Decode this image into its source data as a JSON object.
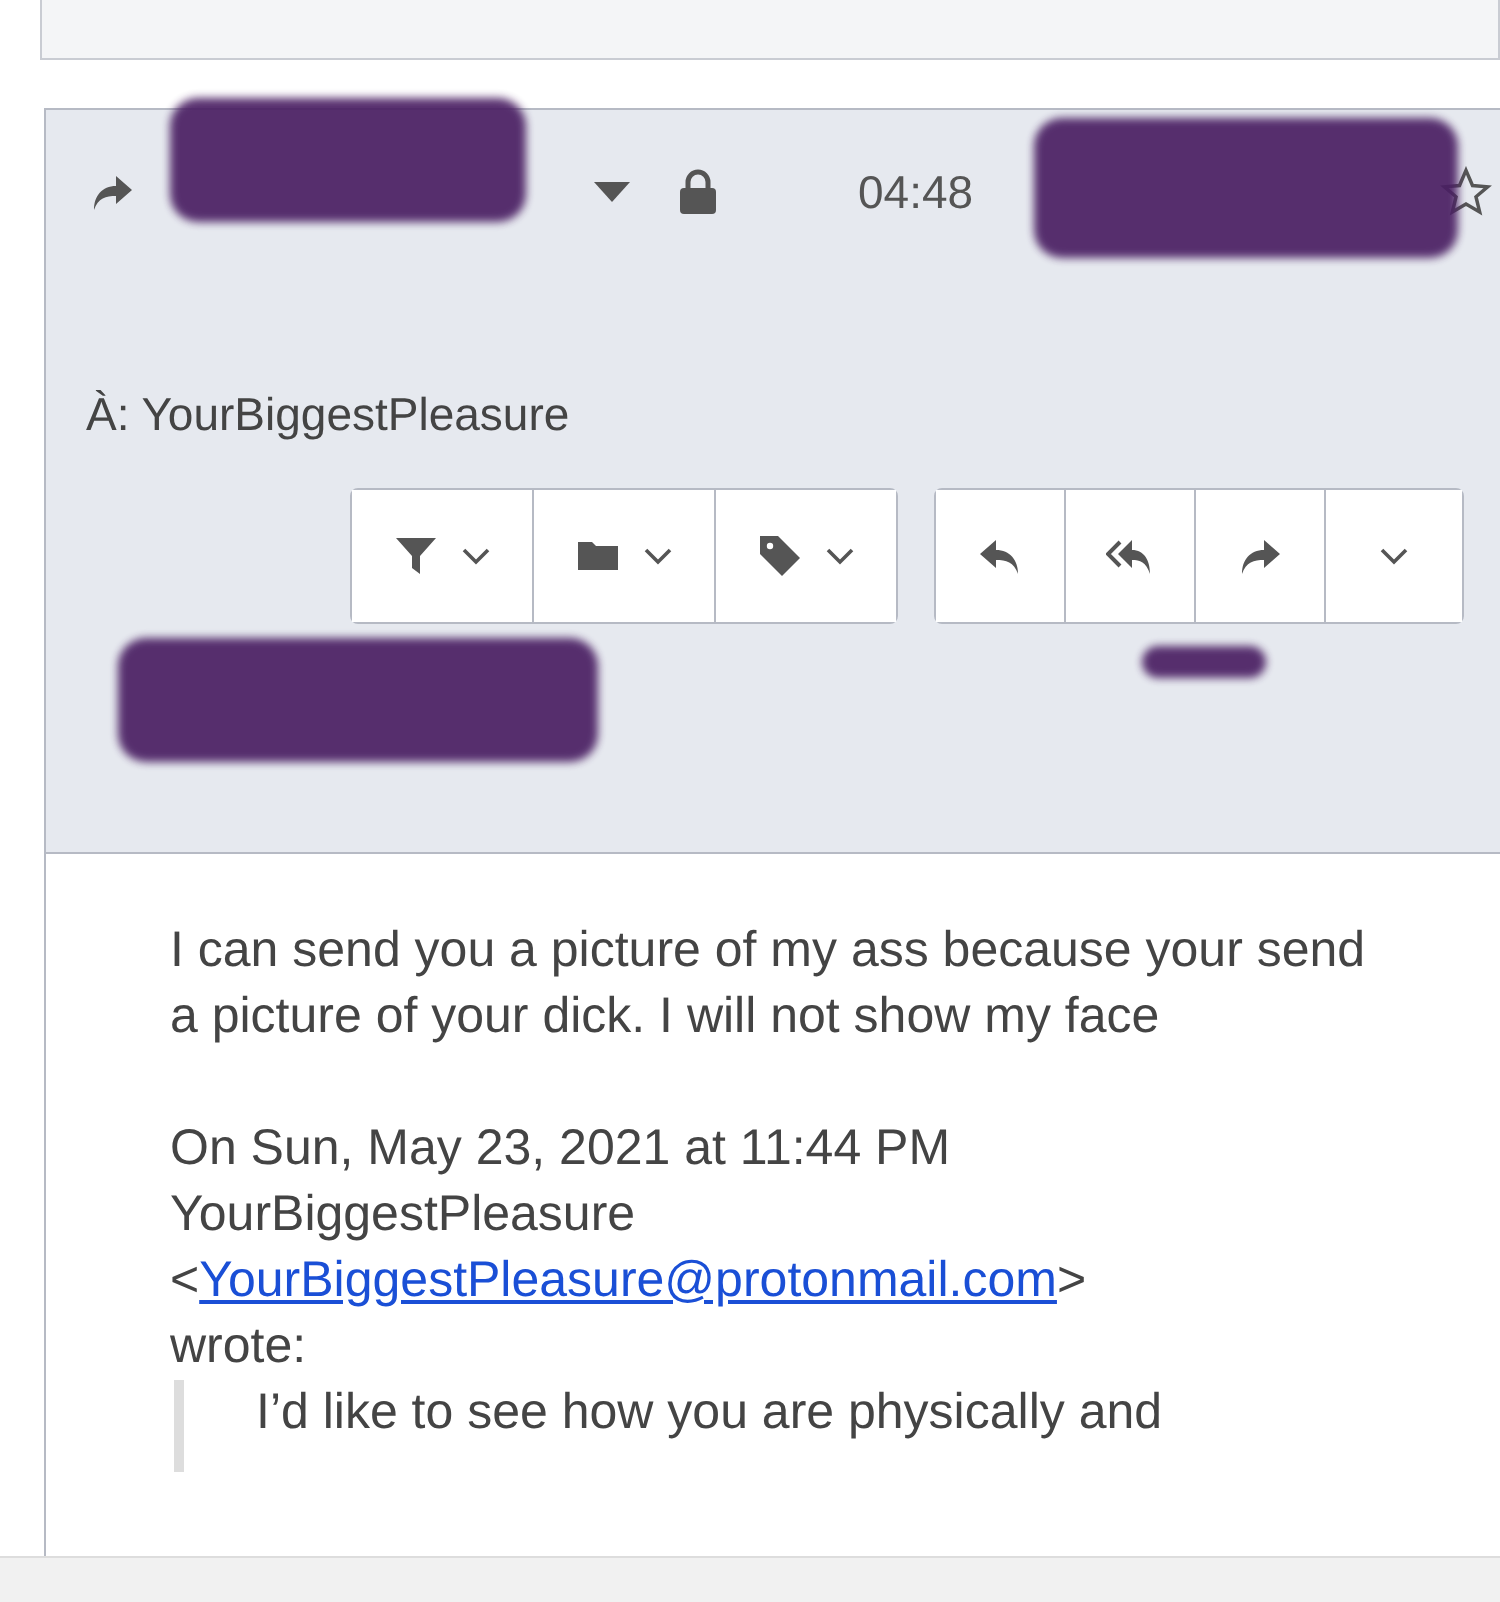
{
  "header": {
    "time": "04:48",
    "starred": false,
    "to_label": "À:",
    "to": "YourBiggestPleasure"
  },
  "toolbar_groups": [
    {
      "buttons": [
        {
          "kind": "filter",
          "caret": true
        },
        {
          "kind": "folder",
          "caret": true
        },
        {
          "kind": "tag",
          "caret": true
        }
      ]
    },
    {
      "buttons": [
        {
          "kind": "reply",
          "caret": false
        },
        {
          "kind": "reply-all",
          "caret": false
        },
        {
          "kind": "forward",
          "caret": false
        },
        {
          "kind": "more",
          "caret": true
        }
      ]
    }
  ],
  "body": {
    "message": "I can send you a picture of my ass because your send a picture of your dick. I will not show my face",
    "quote_header": "On Sun, May 23, 2021 at 11:44 PM",
    "quote_sender": "YourBiggestPleasure",
    "quote_open": "<",
    "quote_email": "YourBiggestPleasure@protonmail.com",
    "quote_close": ">",
    "quote_wrote": "wrote:",
    "quote_text": "I’d like to see how you are physically and"
  }
}
